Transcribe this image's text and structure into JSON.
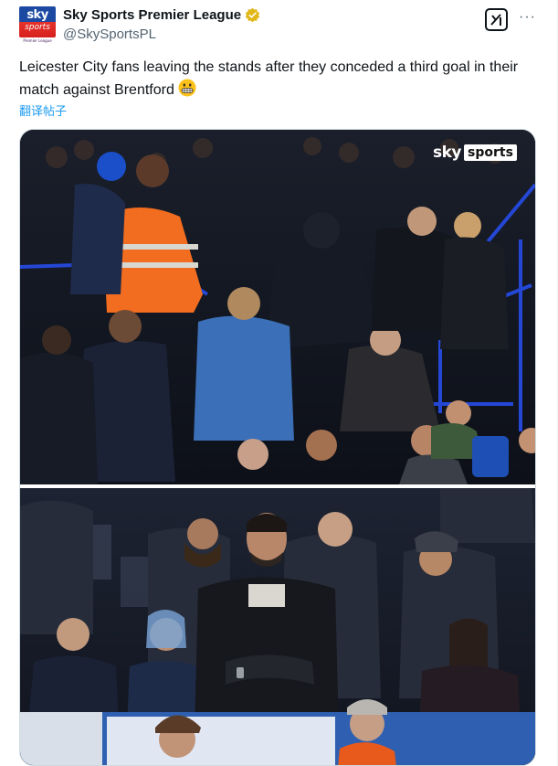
{
  "account": {
    "display_name": "Sky Sports Premier League",
    "handle": "@SkySportsPL",
    "avatar_sky": "sky",
    "avatar_sports": "sports",
    "avatar_league": "Premier League",
    "verified_color": "#e2b719"
  },
  "tweet": {
    "text": "Leicester City fans leaving the stands after they conceded a third goal in their match against Brentford",
    "emoji": "grimacing-face",
    "translate_label": "翻译帖子"
  },
  "actions": {
    "grok_icon": "grok-icon",
    "more_label": "···"
  },
  "media": {
    "watermark_sky": "sky",
    "watermark_sports": "sports"
  },
  "colors": {
    "link": "#1d9bf0",
    "secondary_text": "#536471",
    "primary_text": "#0f1419"
  }
}
